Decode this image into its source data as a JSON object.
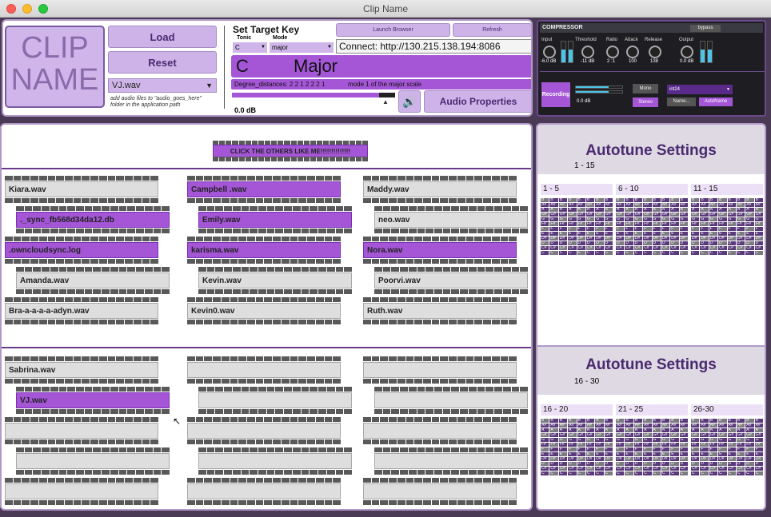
{
  "window": {
    "title": "Clip Name"
  },
  "header": {
    "logo": [
      "CLIP",
      "NAME"
    ],
    "load_label": "Load",
    "reset_label": "Reset",
    "file_select": "VJ.wav",
    "hint": [
      "add audio files to \"audio_goes_here\"",
      "folder in the application path"
    ],
    "set_target_key": "Set Target Key",
    "tonic_label": "Tonic",
    "mode_label": "Mode",
    "tonic_value": "C",
    "mode_value": "major",
    "launch_browser": "Launch Browser",
    "refresh": "Refresh",
    "connect": "Connect: http://130.215.138.194:8086",
    "key_note": "C",
    "key_mode": "Major",
    "degree": "Degree_distances: 2 2 1 2 2 2 1",
    "mode_desc": "mode 1 of the major scale",
    "db": "0.0 dB",
    "volume_fill": 0.9,
    "audio_properties": "Audio Properties"
  },
  "compressor": {
    "title": "COMPRESSOR",
    "bypass": "bypass",
    "labels": [
      "Input",
      "Threshold",
      "Ratio",
      "Attack",
      "Release",
      "Output"
    ],
    "values": [
      "-6.0 dB",
      "-11 dB",
      "2 :1",
      "100",
      "138",
      "0.0 dB"
    ],
    "recording": "Recording",
    "rec_db": "0.0 dB",
    "mono": "Mono",
    "stereo": "Stereo",
    "format": "int24",
    "name_btn": "Name...",
    "autoname": "AutoName"
  },
  "clips": {
    "click_label": "CLICK THE OTHERS LIKE ME!!!!!!!!!!!!!!",
    "items": [
      "Kiara.wav",
      "Campbell .wav",
      "Maddy.wav",
      "._sync_fb568d34da12.db",
      "Emily.wav",
      "neo.wav",
      ".owncloudsync.log",
      "karisma.wav",
      "Nora.wav",
      "Amanda.wav",
      "Kevin.wav",
      "Poorvi.wav",
      "Bra-a-a-a-a-adyn.wav",
      "Kevin0.wav",
      "Ruth.wav",
      "Sabrina.wav",
      "",
      "",
      "VJ.wav",
      "",
      "",
      "",
      "",
      "",
      "",
      "",
      "",
      "",
      "",
      ""
    ]
  },
  "autotune": {
    "title": "Autotune Settings",
    "range1": "1 - 15",
    "range2": "16 - 30",
    "groups1": [
      "1 - 5",
      "6 - 10",
      "11 - 15"
    ],
    "groups2": [
      "16 - 20",
      "21 - 25",
      "26-30"
    ],
    "notes": [
      "B",
      "A#",
      "A",
      "G#",
      "G",
      "F#",
      "F",
      "E",
      "D#",
      "D",
      "C#",
      "C"
    ]
  },
  "colors": {
    "accent": "#a456d6",
    "lavender": "#cfb5ea",
    "dark": "#4a3a56"
  }
}
